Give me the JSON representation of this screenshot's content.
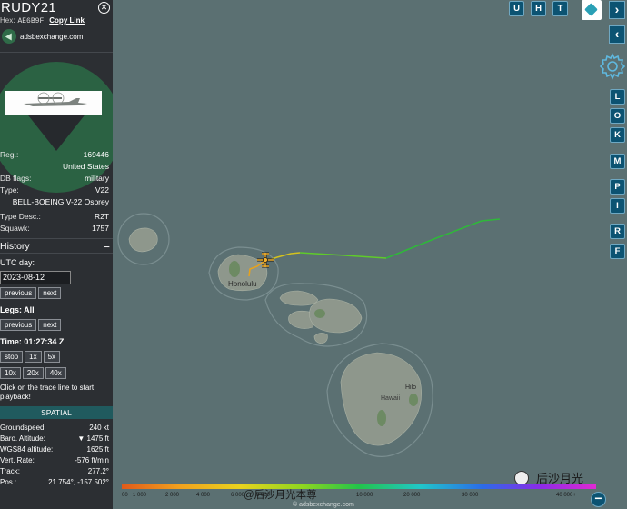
{
  "aircraft": {
    "callsign": "RUDY21",
    "hex_label": "Hex:",
    "hex": "AE6B9F",
    "copy_link": "Copy Link",
    "source": "adsbexchange.com",
    "close_icon": "close-icon"
  },
  "details": {
    "reg_label": "Reg.:",
    "reg": "169446",
    "country": "United States",
    "db_flags_label": "DB flags:",
    "db_flags": "military",
    "type_label": "Type:",
    "type": "V22",
    "type_name": "BELL-BOEING V-22 Osprey",
    "type_desc_label": "Type Desc.:",
    "type_desc": "R2T",
    "squawk_label": "Squawk:",
    "squawk": "1757"
  },
  "history": {
    "title": "History",
    "collapse_symbol": "−",
    "utc_day_label": "UTC day:",
    "date": "2023-08-12",
    "previous": "previous",
    "next": "next",
    "legs_label": "Legs: All",
    "legs_previous": "previous",
    "legs_next": "next",
    "time_label": "Time: 01:27:34 Z",
    "stop": "stop",
    "speed_1x": "1x",
    "speed_5x": "5x",
    "speed_10x": "10x",
    "speed_20x": "20x",
    "speed_40x": "40x",
    "note": "Click on the trace line to start playback!"
  },
  "spatial": {
    "title": "SPATIAL",
    "groundspeed_label": "Groundspeed:",
    "groundspeed": "240 kt",
    "baro_label": "Baro. Altitude:",
    "baro": "▼ 1475 ft",
    "wgs_label": "WGS84 altitude:",
    "wgs": "1625 ft",
    "vert_label": "Vert. Rate:",
    "vert": "-576 ft/min",
    "track_label": "Track:",
    "track": "277.2°",
    "pos_label": "Pos.:",
    "pos": "21.754°, -157.502°"
  },
  "map": {
    "city_label": "Honolulu",
    "hilo_label": "Hilo",
    "hawaii_label": "Hawaii",
    "credit": "© adsbexchange.com",
    "track_colors": [
      "#e8a21c",
      "#d4c21e",
      "#5fcb2a",
      "#2fb83a"
    ]
  },
  "controls": {
    "u": "U",
    "h": "H",
    "t": "T",
    "l": "L",
    "o": "O",
    "k": "K",
    "m": "M",
    "p": "P",
    "i": "I",
    "r": "R",
    "f": "F",
    "chevron_right": "›",
    "chevron_left": "‹",
    "zoom_out": "−"
  },
  "altitude_scale": {
    "ticks": [
      "00",
      "1 000",
      "2 000",
      "4 000",
      "6 000",
      "8 000",
      "10 000",
      "20 000",
      "30 000",
      "40 000+"
    ]
  },
  "watermarks": {
    "weibo": "@后沙月光本尊",
    "wechat": "后沙月光"
  }
}
